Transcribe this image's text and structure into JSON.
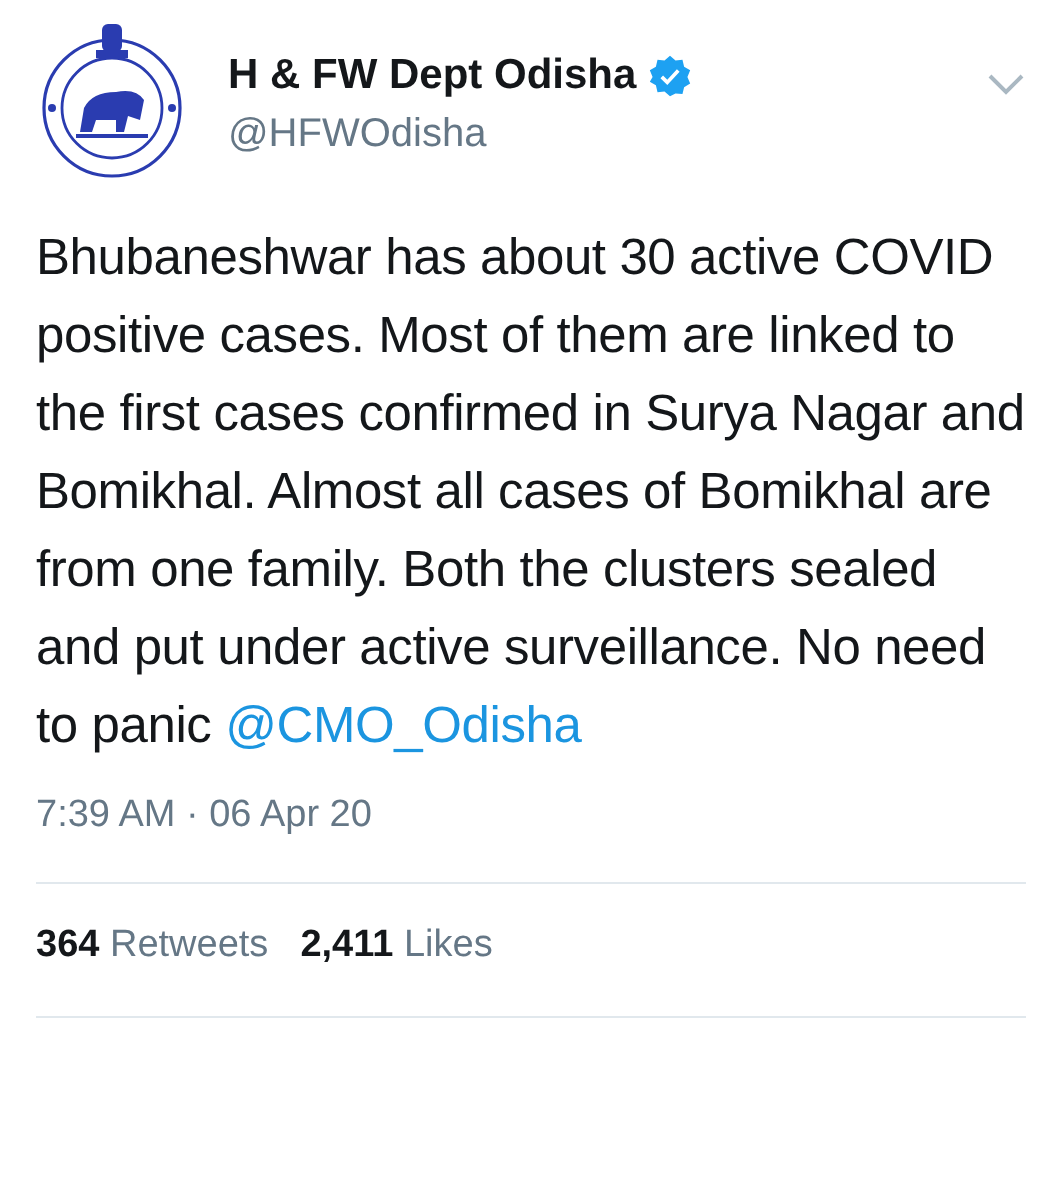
{
  "author": {
    "name": "H & FW Dept Odisha",
    "verified": true,
    "handle": "@HFWOdisha"
  },
  "tweet": {
    "text": "Bhubaneshwar has about 30 active COVID positive cases. Most of them are linked to the first cases confirmed in Surya Nagar and Bomikhal. Almost all cases of Bomikhal are from one family. Both the clusters sealed and put under active surveillance. No need to panic ",
    "mention": "@CMO_Odisha"
  },
  "timestamp": "7:39 AM · 06 Apr 20",
  "stats": [
    {
      "count": "364",
      "label": "Retweets"
    },
    {
      "count": "2,411",
      "label": "Likes"
    }
  ]
}
